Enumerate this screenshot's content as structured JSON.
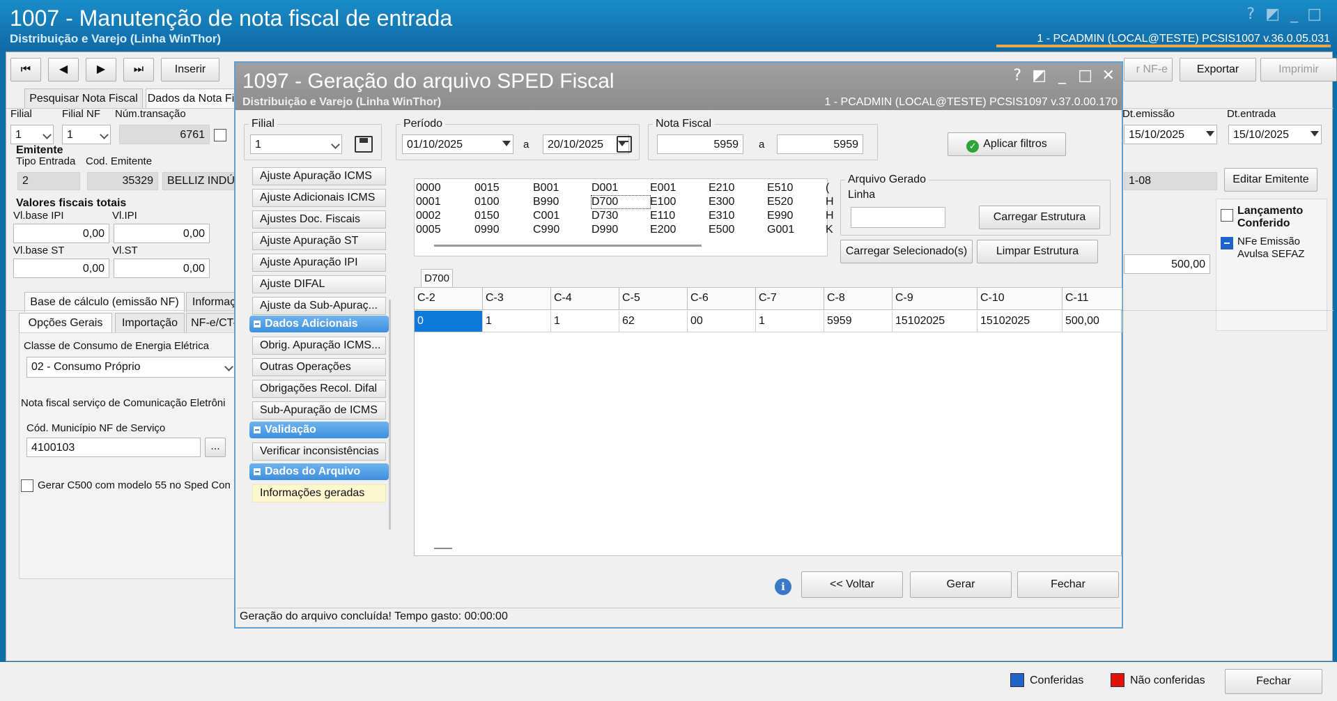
{
  "main_window": {
    "title": "1007 - Manutenção de nota fiscal de entrada",
    "subtitle": "Distribuição e Varejo (Linha WinThor)",
    "version": "1 - PCADMIN (LOCAL@TESTE)   PCSIS1007  v.36.0.05.031",
    "toolbar": {
      "first": "⏮",
      "prev": "◀",
      "next": "▶",
      "last": "⏭",
      "insert_label": "Inserir",
      "nfe_label": "r NF-e",
      "export_label": "Exportar",
      "print_label": "Imprimir"
    },
    "tabs_top": [
      "Pesquisar Nota Fiscal",
      "Dados da Nota Fi"
    ],
    "filial_label": "Filial",
    "filial_nf_label": "Filial NF",
    "num_transacao_label": "Núm.transação",
    "filial_value": "1",
    "filial_nf_value": "1",
    "num_transacao_value": "6761",
    "emitente_label": "Emitente",
    "tipo_entrada_label": "Tipo Entrada",
    "cod_emitente_label": "Cod. Emitente",
    "tipo_entrada_value": "2",
    "cod_emitente_value": "35329",
    "emitente_name": "BELLIZ INDÚS",
    "valores_label": "Valores fiscais totais",
    "vl_base_ipi_label": "Vl.base IPI",
    "vl_ipi_label": "Vl.IPI",
    "vl_base_ipi_value": "0,00",
    "vl_ipi_value": "0,00",
    "vl_base_st_label": "Vl.base ST",
    "vl_st_label": "Vl.ST",
    "vl_base_st_value": "0,00",
    "vl_st_value": "0,00",
    "tabs_mid1": [
      "Base de cálculo (emissão NF)",
      "Informaç"
    ],
    "tabs_mid2": [
      "Opções Gerais",
      "Importação",
      "NF-e/CT-"
    ],
    "classe_label": "Classe de Consumo de Energia Elétrica",
    "classe_value": "02 - Consumo Próprio",
    "nf_servico_label": "Nota fiscal serviço de Comunicação Eletrôni",
    "cod_municipio_label": "Cód. Município NF de Serviço",
    "cod_municipio_value": "4100103",
    "ellipsis": "...",
    "gerar_c500_label": "Gerar C500 com modelo 55 no Sped Con",
    "dt_emissao_label": "Dt.emissão",
    "dt_entrada_label": "Dt.entrada",
    "dt_emissao_value": "15/10/2025",
    "dt_entrada_value": "15/10/2025",
    "editar_emitente_label": "Editar Emitente",
    "field_1_08": "1-08",
    "value_500": "500,00",
    "lancamento_label": "Lançamento Conferido",
    "nfe_emissao_label": "NFe Emissão Avulsa SEFAZ",
    "legend_conferidas": "Conferidas",
    "legend_nao_conferidas": "Não conferidas",
    "fechar_label": "Fechar",
    "colors": {
      "conferidas": "#1e64c8",
      "nao_conferidas": "#e01010",
      "accent": "#0e6fa8"
    }
  },
  "dialog": {
    "title": "1097 - Geração do arquivo SPED Fiscal",
    "subtitle": "Distribuição e Varejo (Linha WinThor)",
    "version": "1 - PCADMIN (LOCAL@TESTE)   PCSIS1097  v.37.0.00.170",
    "filial_label": "Filial",
    "filial_value": "1",
    "periodo_label": "Período",
    "periodo_de": "01/10/2025",
    "periodo_a_label": "a",
    "periodo_ate": "20/10/2025",
    "nota_fiscal_label": "Nota Fiscal",
    "nf_de": "5959",
    "nf_a_label": "a",
    "nf_ate": "5959",
    "aplicar_filtros_label": "Aplicar filtros",
    "nav_items_top": [
      "Ajuste Apuração ICMS",
      "Ajuste Adicionais ICMS",
      "Ajustes Doc. Fiscais",
      "Ajuste Apuração ST",
      "Ajuste Apuração IPI",
      "Ajuste DIFAL",
      "Ajuste da Sub-Apuraç..."
    ],
    "nav_header_adicionais": "Dados Adicionais",
    "nav_items_adicionais": [
      "Obrig. Apuração ICMS...",
      "Outras Operações",
      "Obrigações Recol. Difal",
      "Sub-Apuração de ICMS"
    ],
    "nav_header_validacao": "Validação",
    "nav_items_validacao": [
      "Verificar inconsistências"
    ],
    "nav_header_arquivo": "Dados do Arquivo",
    "nav_items_arquivo": [
      "Informações geradas"
    ],
    "registros": [
      [
        "0000",
        "0015",
        "B001",
        "D001",
        "E001",
        "E210",
        "E510",
        "("
      ],
      [
        "0001",
        "0100",
        "B990",
        "D700",
        "E100",
        "E300",
        "E520",
        "H"
      ],
      [
        "0002",
        "0150",
        "C001",
        "D730",
        "E110",
        "E310",
        "E990",
        "H"
      ],
      [
        "0005",
        "0990",
        "C990",
        "D990",
        "E200",
        "E500",
        "G001",
        "K"
      ]
    ],
    "arquivo_gerado_label": "Arquivo Gerado",
    "linha_label": "Linha",
    "linha_value": "",
    "carregar_estrutura_label": "Carregar Estrutura",
    "carregar_selecionados_label": "Carregar Selecionado(s)",
    "limpar_estrutura_label": "Limpar Estrutura",
    "grid_tab": "D700",
    "grid_columns": [
      "C-2",
      "C-3",
      "C-4",
      "C-5",
      "C-6",
      "C-7",
      "C-8",
      "C-9",
      "C-10",
      "C-11"
    ],
    "grid_rows": [
      [
        "0",
        "1",
        "1",
        "62",
        "00",
        "1",
        "5959",
        "15102025",
        "15102025",
        "500,00"
      ]
    ],
    "voltar_label": "<< Voltar",
    "gerar_label": "Gerar",
    "fechar_label": "Fechar",
    "status_text": "Geração do arquivo concluída! Tempo gasto: 00:00:00"
  }
}
